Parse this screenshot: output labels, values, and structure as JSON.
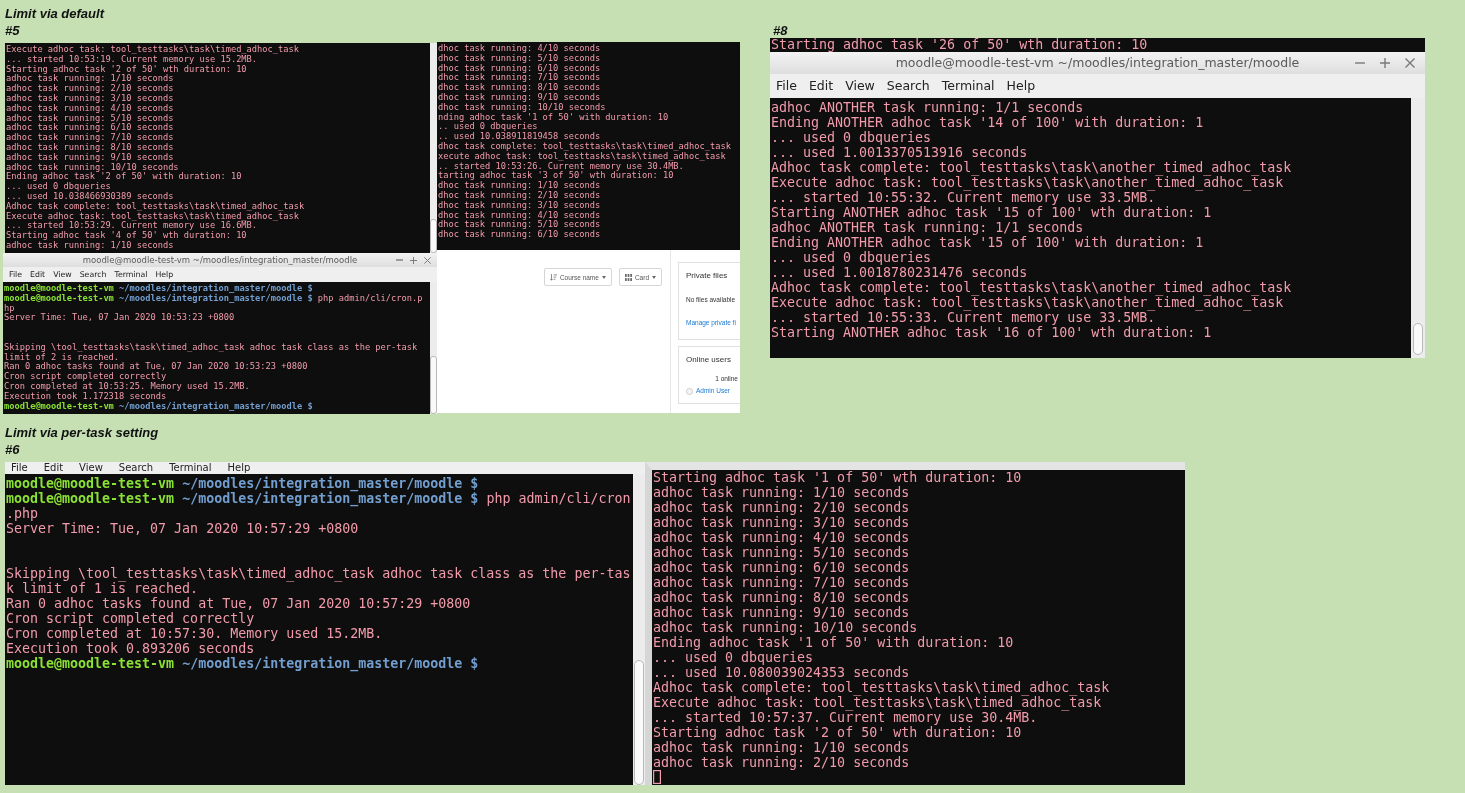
{
  "sections": [
    {
      "title": "Limit via default",
      "shots": [
        {
          "label": "#5",
          "panes": [
            {
              "kind": "terminal",
              "lines": [
                {
                  "kind": "output",
                  "text": "Execute adhoc task: tool_testtasks\\task\\timed_adhoc_task"
                },
                {
                  "kind": "output",
                  "text": "... started 10:53:19. Current memory use 15.2MB."
                },
                {
                  "kind": "output",
                  "text": "Starting adhoc task '2 of 50' wth duration: 10"
                },
                {
                  "kind": "output",
                  "text": "adhoc task running: 1/10 seconds"
                },
                {
                  "kind": "output",
                  "text": "adhoc task running: 2/10 seconds"
                },
                {
                  "kind": "output",
                  "text": "adhoc task running: 3/10 seconds"
                },
                {
                  "kind": "output",
                  "text": "adhoc task running: 4/10 seconds"
                },
                {
                  "kind": "output",
                  "text": "adhoc task running: 5/10 seconds"
                },
                {
                  "kind": "output",
                  "text": "adhoc task running: 6/10 seconds"
                },
                {
                  "kind": "output",
                  "text": "adhoc task running: 7/10 seconds"
                },
                {
                  "kind": "output",
                  "text": "adhoc task running: 8/10 seconds"
                },
                {
                  "kind": "output",
                  "text": "adhoc task running: 9/10 seconds"
                },
                {
                  "kind": "output",
                  "text": "adhoc task running: 10/10 seconds"
                },
                {
                  "kind": "output",
                  "text": "Ending adhoc task '2 of 50' with duration: 10"
                },
                {
                  "kind": "output",
                  "text": "... used 0 dbqueries"
                },
                {
                  "kind": "output",
                  "text": "... used 10.038466930389 seconds"
                },
                {
                  "kind": "output",
                  "text": "Adhoc task complete: tool_testtasks\\task\\timed_adhoc_task"
                },
                {
                  "kind": "output",
                  "text": "Execute adhoc task: tool_testtasks\\task\\timed_adhoc_task"
                },
                {
                  "kind": "output",
                  "text": "... started 10:53:29. Current memory use 16.6MB."
                },
                {
                  "kind": "output",
                  "text": "Starting adhoc task '4 of 50' wth duration: 10"
                },
                {
                  "kind": "output",
                  "text": "adhoc task running: 1/10 seconds"
                }
              ]
            },
            {
              "kind": "terminal",
              "lines": [
                {
                  "kind": "output",
                  "text": "dhoc task running: 4/10 seconds"
                },
                {
                  "kind": "output",
                  "text": "dhoc task running: 5/10 seconds"
                },
                {
                  "kind": "output",
                  "text": "dhoc task running: 6/10 seconds"
                },
                {
                  "kind": "output",
                  "text": "dhoc task running: 7/10 seconds"
                },
                {
                  "kind": "output",
                  "text": "dhoc task running: 8/10 seconds"
                },
                {
                  "kind": "output",
                  "text": "dhoc task running: 9/10 seconds"
                },
                {
                  "kind": "output",
                  "text": "dhoc task running: 10/10 seconds"
                },
                {
                  "kind": "output",
                  "text": "nding adhoc task '1 of 50' with duration: 10"
                },
                {
                  "kind": "output",
                  "text": ".. used 0 dbqueries"
                },
                {
                  "kind": "output",
                  "text": ".. used 10.038911819458 seconds"
                },
                {
                  "kind": "output",
                  "text": "dhoc task complete: tool_testtasks\\task\\timed_adhoc_task"
                },
                {
                  "kind": "output",
                  "text": "xecute adhoc task: tool_testtasks\\task\\timed_adhoc_task"
                },
                {
                  "kind": "output",
                  "text": ".. started 10:53:26. Current memory use 30.4MB."
                },
                {
                  "kind": "output",
                  "text": "tarting adhoc task '3 of 50' wth duration: 10"
                },
                {
                  "kind": "output",
                  "text": "dhoc task running: 1/10 seconds"
                },
                {
                  "kind": "output",
                  "text": "dhoc task running: 2/10 seconds"
                },
                {
                  "kind": "output",
                  "text": "dhoc task running: 3/10 seconds"
                },
                {
                  "kind": "output",
                  "text": "dhoc task running: 4/10 seconds"
                },
                {
                  "kind": "output",
                  "text": "dhoc task running: 5/10 seconds"
                },
                {
                  "kind": "output",
                  "text": "dhoc task running: 6/10 seconds"
                }
              ]
            },
            {
              "kind": "window",
              "title": "moodle@moodle-test-vm ~/moodles/integration_master/moodle",
              "menu": [
                "File",
                "Edit",
                "View",
                "Search",
                "Terminal",
                "Help"
              ],
              "lines": [
                {
                  "kind": "prompt",
                  "user": "moodle@moodle-test-vm",
                  "path": "~/moodles/integration_master/moodle",
                  "sign": "$"
                },
                {
                  "kind": "prompt",
                  "user": "moodle@moodle-test-vm",
                  "path": "~/moodles/integration_master/moodle",
                  "sign": "$",
                  "command": "php admin/cli/cron.p"
                },
                {
                  "kind": "output",
                  "text": "hp"
                },
                {
                  "kind": "output",
                  "text": "Server Time: Tue, 07 Jan 2020 10:53:23 +0800"
                },
                {
                  "kind": "blank"
                },
                {
                  "kind": "blank"
                },
                {
                  "kind": "output",
                  "text": "Skipping \\tool_testtasks\\task\\timed_adhoc_task adhoc task class as the per-task"
                },
                {
                  "kind": "output",
                  "text": "limit of 2 is reached."
                },
                {
                  "kind": "output",
                  "text": "Ran 0 adhoc tasks found at Tue, 07 Jan 2020 10:53:23 +0800"
                },
                {
                  "kind": "output",
                  "text": "Cron script completed correctly"
                },
                {
                  "kind": "output",
                  "text": "Cron completed at 10:53:25. Memory used 15.2MB."
                },
                {
                  "kind": "output",
                  "text": "Execution took 1.172318 seconds"
                },
                {
                  "kind": "prompt",
                  "user": "moodle@moodle-test-vm",
                  "path": "~/moodles/integration_master/moodle",
                  "sign": "$"
                }
              ]
            },
            {
              "kind": "web_page",
              "buttons": [
                {
                  "label": "Course name"
                },
                {
                  "label": "Card"
                }
              ],
              "cards": [
                {
                  "title": "Private files",
                  "items": [
                    {
                      "kind": "text",
                      "text": "No files available"
                    },
                    {
                      "kind": "link",
                      "text": "Manage private fi"
                    }
                  ]
                },
                {
                  "title": "Online users",
                  "items": [
                    {
                      "kind": "count",
                      "text": "1 online"
                    },
                    {
                      "kind": "user",
                      "text": "Admin User"
                    }
                  ]
                }
              ]
            }
          ]
        },
        {
          "label": "#8",
          "panes": [
            {
              "kind": "terminal",
              "lines": [
                {
                  "kind": "output",
                  "text": "Starting adhoc task '26 of 50' wth duration: 10"
                }
              ]
            },
            {
              "kind": "window",
              "title": "moodle@moodle-test-vm ~/moodles/integration_master/moodle",
              "menu": [
                "File",
                "Edit",
                "View",
                "Search",
                "Terminal",
                "Help"
              ],
              "lines": [
                {
                  "kind": "output",
                  "text": "adhoc ANOTHER task running: 1/1 seconds"
                },
                {
                  "kind": "output",
                  "text": "Ending ANOTHER adhoc task '14 of 100' with duration: 1"
                },
                {
                  "kind": "output",
                  "text": "... used 0 dbqueries"
                },
                {
                  "kind": "output",
                  "text": "... used 1.0013370513916 seconds"
                },
                {
                  "kind": "output",
                  "text": "Adhoc task complete: tool_testtasks\\task\\another_timed_adhoc_task"
                },
                {
                  "kind": "output",
                  "text": "Execute adhoc task: tool_testtasks\\task\\another_timed_adhoc_task"
                },
                {
                  "kind": "output",
                  "text": "... started 10:55:32. Current memory use 33.5MB."
                },
                {
                  "kind": "output",
                  "text": "Starting ANOTHER adhoc task '15 of 100' wth duration: 1"
                },
                {
                  "kind": "output",
                  "text": "adhoc ANOTHER task running: 1/1 seconds"
                },
                {
                  "kind": "output",
                  "text": "Ending ANOTHER adhoc task '15 of 100' with duration: 1"
                },
                {
                  "kind": "output",
                  "text": "... used 0 dbqueries"
                },
                {
                  "kind": "output",
                  "text": "... used 1.0018780231476 seconds"
                },
                {
                  "kind": "output",
                  "text": "Adhoc task complete: tool_testtasks\\task\\another_timed_adhoc_task"
                },
                {
                  "kind": "output",
                  "text": "Execute adhoc task: tool_testtasks\\task\\another_timed_adhoc_task"
                },
                {
                  "kind": "output",
                  "text": "... started 10:55:33. Current memory use 33.5MB."
                },
                {
                  "kind": "output",
                  "text": "Starting ANOTHER adhoc task '16 of 100' wth duration: 1"
                }
              ]
            }
          ]
        }
      ]
    },
    {
      "title": "Limit via per-task setting",
      "shots": [
        {
          "label": "#6",
          "panes": [
            {
              "kind": "window",
              "menu": [
                "File",
                "Edit",
                "View",
                "Search",
                "Terminal",
                "Help"
              ],
              "lines": [
                {
                  "kind": "prompt",
                  "user": "moodle@moodle-test-vm",
                  "path": "~/moodles/integration_master/moodle",
                  "sign": "$"
                },
                {
                  "kind": "prompt",
                  "user": "moodle@moodle-test-vm",
                  "path": "~/moodles/integration_master/moodle",
                  "sign": "$",
                  "command": "php admin/cli/cron"
                },
                {
                  "kind": "output",
                  "text": ".php"
                },
                {
                  "kind": "output",
                  "text": "Server Time: Tue, 07 Jan 2020 10:57:29 +0800"
                },
                {
                  "kind": "blank"
                },
                {
                  "kind": "blank"
                },
                {
                  "kind": "output",
                  "text": "Skipping \\tool_testtasks\\task\\timed_adhoc_task adhoc task class as the per-tas"
                },
                {
                  "kind": "output",
                  "text": "k limit of 1 is reached."
                },
                {
                  "kind": "output",
                  "text": "Ran 0 adhoc tasks found at Tue, 07 Jan 2020 10:57:29 +0800"
                },
                {
                  "kind": "output",
                  "text": "Cron script completed correctly"
                },
                {
                  "kind": "output",
                  "text": "Cron completed at 10:57:30. Memory used 15.2MB."
                },
                {
                  "kind": "output",
                  "text": "Execution took 0.893206 seconds"
                },
                {
                  "kind": "prompt",
                  "user": "moodle@moodle-test-vm",
                  "path": "~/moodles/integration_master/moodle",
                  "sign": "$"
                }
              ]
            },
            {
              "kind": "terminal",
              "lines": [
                {
                  "kind": "output",
                  "text": "Starting adhoc task '1 of 50' wth duration: 10"
                },
                {
                  "kind": "output",
                  "text": "adhoc task running: 1/10 seconds"
                },
                {
                  "kind": "output",
                  "text": "adhoc task running: 2/10 seconds"
                },
                {
                  "kind": "output",
                  "text": "adhoc task running: 3/10 seconds"
                },
                {
                  "kind": "output",
                  "text": "adhoc task running: 4/10 seconds"
                },
                {
                  "kind": "output",
                  "text": "adhoc task running: 5/10 seconds"
                },
                {
                  "kind": "output",
                  "text": "adhoc task running: 6/10 seconds"
                },
                {
                  "kind": "output",
                  "text": "adhoc task running: 7/10 seconds"
                },
                {
                  "kind": "output",
                  "text": "adhoc task running: 8/10 seconds"
                },
                {
                  "kind": "output",
                  "text": "adhoc task running: 9/10 seconds"
                },
                {
                  "kind": "output",
                  "text": "adhoc task running: 10/10 seconds"
                },
                {
                  "kind": "output",
                  "text": "Ending adhoc task '1 of 50' with duration: 10"
                },
                {
                  "kind": "output",
                  "text": "... used 0 dbqueries"
                },
                {
                  "kind": "output",
                  "text": "... used 10.080039024353 seconds"
                },
                {
                  "kind": "output",
                  "text": "Adhoc task complete: tool_testtasks\\task\\timed_adhoc_task"
                },
                {
                  "kind": "output",
                  "text": "Execute adhoc task: tool_testtasks\\task\\timed_adhoc_task"
                },
                {
                  "kind": "output",
                  "text": "... started 10:57:37. Current memory use 30.4MB."
                },
                {
                  "kind": "output",
                  "text": "Starting adhoc task '2 of 50' wth duration: 10"
                },
                {
                  "kind": "output",
                  "text": "adhoc task running: 1/10 seconds"
                },
                {
                  "kind": "output",
                  "text": "adhoc task running: 2/10 seconds"
                },
                {
                  "kind": "cursor"
                }
              ]
            }
          ]
        }
      ]
    }
  ]
}
